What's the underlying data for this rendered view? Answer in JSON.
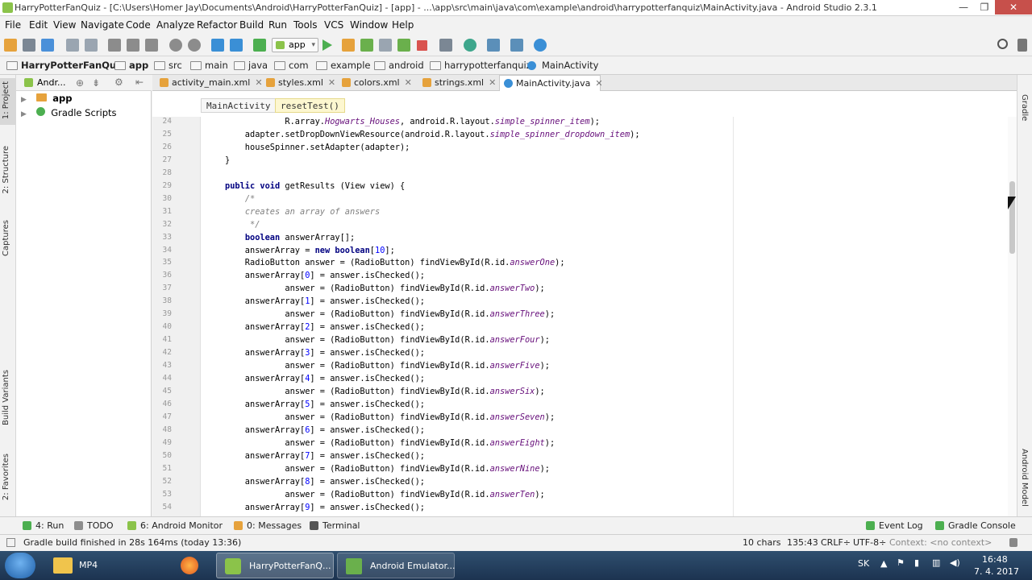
{
  "window": {
    "title": "HarryPotterFanQuiz - [C:\\Users\\Homer Jay\\Documents\\Android\\HarryPotterFanQuiz] - [app] - ...\\app\\src\\main\\java\\com\\example\\android\\harrypotterfanquiz\\MainActivity.java - Android Studio 2.3.1",
    "minimize": "—",
    "maximize": "❐",
    "close": "✕"
  },
  "menu": [
    "File",
    "Edit",
    "View",
    "Navigate",
    "Code",
    "Analyze",
    "Refactor",
    "Build",
    "Run",
    "Tools",
    "VCS",
    "Window",
    "Help"
  ],
  "toolbar": {
    "run_config": "app"
  },
  "breadcrumbs": [
    "HarryPotterFanQuiz",
    "app",
    "src",
    "main",
    "java",
    "com",
    "example",
    "android",
    "harrypotterfanquiz",
    "MainActivity"
  ],
  "left_stripe": [
    "1: Project",
    "2: Structure",
    "Captures",
    "Build Variants",
    "2: Favorites"
  ],
  "right_stripe": [
    "Gradle",
    "Android Model"
  ],
  "project_panel": {
    "view_selector": "Andr...",
    "tree": [
      {
        "label": "app",
        "bold": true
      },
      {
        "label": "Gradle Scripts",
        "bold": false
      }
    ]
  },
  "tabs": [
    {
      "label": "activity_main.xml",
      "active": false,
      "color": "#e6a23c"
    },
    {
      "label": "styles.xml",
      "active": false,
      "color": "#e6a23c"
    },
    {
      "label": "colors.xml",
      "active": false,
      "color": "#e6a23c"
    },
    {
      "label": "strings.xml",
      "active": false,
      "color": "#e6a23c"
    },
    {
      "label": "MainActivity.java",
      "active": true,
      "color": "#3a8fd6"
    }
  ],
  "tab_close": "✕",
  "editor_breadcrumbs": [
    "MainActivity",
    "resetTest()"
  ],
  "code_lines": [
    {
      "n": "24",
      "html": "            R.array.<span class=\"it\">Hogwarts_Houses</span>, android.R.layout.<span class=\"it\">simple_spinner_item</span>);"
    },
    {
      "n": "25",
      "html": "    adapter.setDropDownViewResource(android.R.layout.<span class=\"it\">simple_spinner_dropdown_item</span>);"
    },
    {
      "n": "26",
      "html": "    houseSpinner.setAdapter(adapter);"
    },
    {
      "n": "27",
      "html": "}"
    },
    {
      "n": "28",
      "html": ""
    },
    {
      "n": "29",
      "html": "<span class=\"kw\">public void</span> getResults (View view) {"
    },
    {
      "n": "30",
      "html": "    <span class=\"cm\">/*</span>"
    },
    {
      "n": "31",
      "html": "    <span class=\"cm\">creates an array of answers</span>"
    },
    {
      "n": "32",
      "html": "    <span class=\"cm\"> */</span>"
    },
    {
      "n": "33",
      "html": "    <span class=\"kw\">boolean</span> answerArray[];"
    },
    {
      "n": "34",
      "html": "    answerArray = <span class=\"kw\">new boolean</span>[<span class=\"num\">10</span>];"
    },
    {
      "n": "35",
      "html": "    RadioButton answer = (RadioButton) findViewById(R.id.<span class=\"it\">answerOne</span>);"
    },
    {
      "n": "36",
      "html": "    answerArray[<span class=\"num\">0</span>] = answer.isChecked();"
    },
    {
      "n": "37",
      "html": "            answer = (RadioButton) findViewById(R.id.<span class=\"it\">answerTwo</span>);"
    },
    {
      "n": "38",
      "html": "    answerArray[<span class=\"num\">1</span>] = answer.isChecked();"
    },
    {
      "n": "39",
      "html": "            answer = (RadioButton) findViewById(R.id.<span class=\"it\">answerThree</span>);"
    },
    {
      "n": "40",
      "html": "    answerArray[<span class=\"num\">2</span>] = answer.isChecked();"
    },
    {
      "n": "41",
      "html": "            answer = (RadioButton) findViewById(R.id.<span class=\"it\">answerFour</span>);"
    },
    {
      "n": "42",
      "html": "    answerArray[<span class=\"num\">3</span>] = answer.isChecked();"
    },
    {
      "n": "43",
      "html": "            answer = (RadioButton) findViewById(R.id.<span class=\"it\">answerFive</span>);"
    },
    {
      "n": "44",
      "html": "    answerArray[<span class=\"num\">4</span>] = answer.isChecked();"
    },
    {
      "n": "45",
      "html": "            answer = (RadioButton) findViewById(R.id.<span class=\"it\">answerSix</span>);"
    },
    {
      "n": "46",
      "html": "    answerArray[<span class=\"num\">5</span>] = answer.isChecked();"
    },
    {
      "n": "47",
      "html": "            answer = (RadioButton) findViewById(R.id.<span class=\"it\">answerSeven</span>);"
    },
    {
      "n": "48",
      "html": "    answerArray[<span class=\"num\">6</span>] = answer.isChecked();"
    },
    {
      "n": "49",
      "html": "            answer = (RadioButton) findViewById(R.id.<span class=\"it\">answerEight</span>);"
    },
    {
      "n": "50",
      "html": "    answerArray[<span class=\"num\">7</span>] = answer.isChecked();"
    },
    {
      "n": "51",
      "html": "            answer = (RadioButton) findViewById(R.id.<span class=\"it\">answerNine</span>);"
    },
    {
      "n": "52",
      "html": "    answerArray[<span class=\"num\">8</span>] = answer.isChecked();"
    },
    {
      "n": "53",
      "html": "            answer = (RadioButton) findViewById(R.id.<span class=\"it\">answerTen</span>);"
    },
    {
      "n": "54",
      "html": "    answerArray[<span class=\"num\">9</span>] = answer.isChecked();"
    }
  ],
  "bottom_tools": [
    {
      "label": "4: Run",
      "color": "#4caf50"
    },
    {
      "label": "TODO",
      "color": "#8d8d8d"
    },
    {
      "label": "6: Android Monitor",
      "color": "#8bc34a"
    },
    {
      "label": "0: Messages",
      "color": "#e6a23c"
    },
    {
      "label": "Terminal",
      "color": "#555555"
    }
  ],
  "bottom_right_tools": [
    {
      "label": "Event Log",
      "color": "#4caf50"
    },
    {
      "label": "Gradle Console",
      "color": "#4caf50"
    }
  ],
  "status": {
    "message": "Gradle build finished in 28s 164ms (today 13:36)",
    "chars": "10 chars",
    "position": "135:43",
    "line_sep": "CRLF÷",
    "encoding": "UTF-8÷",
    "context": "Context: <no context>"
  },
  "taskbar": {
    "items": [
      {
        "label": "MP4",
        "active": false
      },
      {
        "label": "",
        "active": false
      },
      {
        "label": "HarryPotterFanQ...",
        "active": true
      },
      {
        "label": "Android Emulator...",
        "active": true
      }
    ],
    "lang": "SK",
    "time": "16:48",
    "date": "7. 4. 2017"
  }
}
